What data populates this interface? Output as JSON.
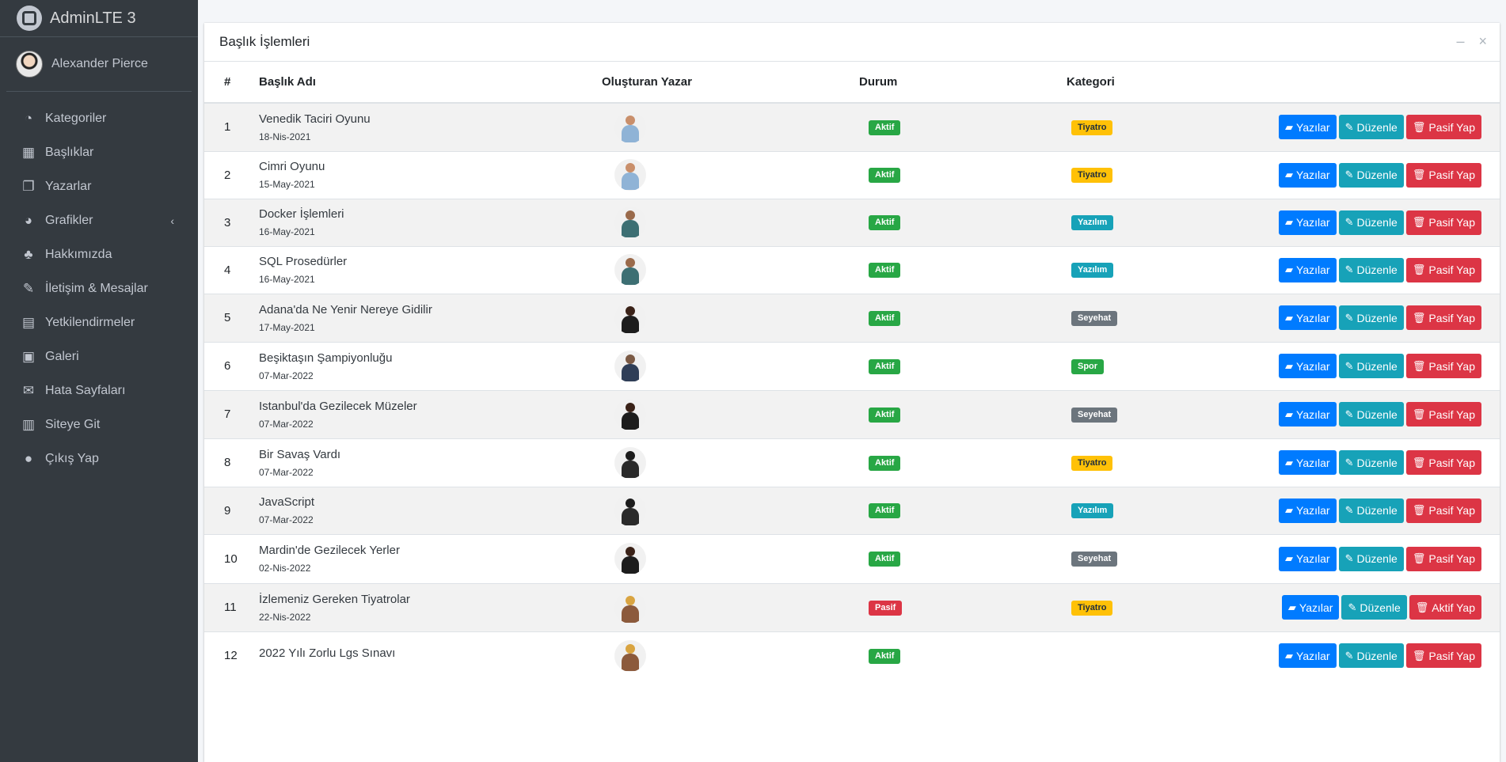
{
  "brand": {
    "name": "AdminLTE 3"
  },
  "user": {
    "name": "Alexander Pierce"
  },
  "sidebar": {
    "items": [
      {
        "label": "Kategoriler",
        "icon": "tachometer-icon",
        "glyph": "◔"
      },
      {
        "label": "Başlıklar",
        "icon": "grid-icon",
        "glyph": "▦"
      },
      {
        "label": "Yazarlar",
        "icon": "copy-icon",
        "glyph": "❐"
      },
      {
        "label": "Grafikler",
        "icon": "pie-chart-icon",
        "glyph": "◕",
        "chevron": "‹"
      },
      {
        "label": "Hakkımızda",
        "icon": "tree-icon",
        "glyph": "♣"
      },
      {
        "label": "İletişim & Mesajlar",
        "icon": "edit-icon",
        "glyph": "✎"
      },
      {
        "label": "Yetkilendirmeler",
        "icon": "calendar-icon",
        "glyph": "▤"
      },
      {
        "label": "Galeri",
        "icon": "image-icon",
        "glyph": "▣"
      },
      {
        "label": "Hata Sayfaları",
        "icon": "envelope-icon",
        "glyph": "✉"
      },
      {
        "label": "Siteye Git",
        "icon": "book-icon",
        "glyph": "▥"
      },
      {
        "label": "Çıkış Yap",
        "icon": "apple-icon",
        "glyph": "●"
      }
    ]
  },
  "card": {
    "title": "Başlık İşlemleri",
    "minimize": "–",
    "close": "×"
  },
  "table": {
    "headers": {
      "num": "#",
      "title": "Başlık Adı",
      "author": "Oluşturan Yazar",
      "status": "Durum",
      "category": "Kategori"
    },
    "buttons": {
      "posts": "Yazılar",
      "edit": "Düzenle"
    },
    "rows": [
      {
        "num": "1",
        "title": "Venedik Taciri Oyunu",
        "date": "18-Nis-2021",
        "author_avatar": "woman-blue",
        "status": "Aktif",
        "category": "Tiyatro",
        "toggle": "Pasif Yap"
      },
      {
        "num": "2",
        "title": "Cimri Oyunu",
        "date": "15-May-2021",
        "author_avatar": "woman-blue",
        "status": "Aktif",
        "category": "Tiyatro",
        "toggle": "Pasif Yap"
      },
      {
        "num": "3",
        "title": "Docker İşlemleri",
        "date": "16-May-2021",
        "author_avatar": "man-teal",
        "status": "Aktif",
        "category": "Yazılım",
        "toggle": "Pasif Yap"
      },
      {
        "num": "4",
        "title": "SQL Prosedürler",
        "date": "16-May-2021",
        "author_avatar": "man-teal",
        "status": "Aktif",
        "category": "Yazılım",
        "toggle": "Pasif Yap"
      },
      {
        "num": "5",
        "title": "Adana'da Ne Yenir Nereye Gidilir",
        "date": "17-May-2021",
        "author_avatar": "woman-dark",
        "status": "Aktif",
        "category": "Seyehat",
        "toggle": "Pasif Yap"
      },
      {
        "num": "6",
        "title": "Beşiktaşın Şampiyonluğu",
        "date": "07-Mar-2022",
        "author_avatar": "man-suit",
        "status": "Aktif",
        "category": "Spor",
        "toggle": "Pasif Yap"
      },
      {
        "num": "7",
        "title": "Istanbul'da Gezilecek Müzeler",
        "date": "07-Mar-2022",
        "author_avatar": "woman-dark",
        "status": "Aktif",
        "category": "Seyehat",
        "toggle": "Pasif Yap"
      },
      {
        "num": "8",
        "title": "Bir Savaş Vardı",
        "date": "07-Mar-2022",
        "author_avatar": "man-laptop",
        "status": "Aktif",
        "category": "Tiyatro",
        "toggle": "Pasif Yap"
      },
      {
        "num": "9",
        "title": "JavaScript",
        "date": "07-Mar-2022",
        "author_avatar": "man-laptop",
        "status": "Aktif",
        "category": "Yazılım",
        "toggle": "Pasif Yap"
      },
      {
        "num": "10",
        "title": "Mardin'de Gezilecek Yerler",
        "date": "02-Nis-2022",
        "author_avatar": "woman-dark",
        "status": "Aktif",
        "category": "Seyehat",
        "toggle": "Pasif Yap"
      },
      {
        "num": "11",
        "title": "İzlemeniz Gereken Tiyatrolar",
        "date": "22-Nis-2022",
        "author_avatar": "cartoon",
        "status": "Pasif",
        "category": "Tiyatro",
        "toggle": "Aktif Yap"
      },
      {
        "num": "12",
        "title": "2022 Yılı Zorlu Lgs Sınavı",
        "date": "",
        "author_avatar": "cartoon",
        "status": "Aktif",
        "category": "",
        "toggle": "Pasif Yap"
      }
    ]
  },
  "colors": {
    "status": {
      "Aktif": "#28a745",
      "Pasif": "#dc3545"
    },
    "category": {
      "Tiyatro": "#ffc107",
      "Yazılım": "#17a2b8",
      "Seyehat": "#6c757d",
      "Spor": "#28a745"
    },
    "avatars": {
      "woman-blue": [
        "#c98f6b",
        "#8fb3d6"
      ],
      "man-teal": [
        "#9a6a4b",
        "#3d6f73"
      ],
      "woman-dark": [
        "#3a2218",
        "#1d1d1d"
      ],
      "man-suit": [
        "#7b5a45",
        "#2f3e57"
      ],
      "man-laptop": [
        "#1c1c1c",
        "#2a2a2a"
      ],
      "cartoon": [
        "#d9a441",
        "#8c5a3c"
      ]
    }
  }
}
